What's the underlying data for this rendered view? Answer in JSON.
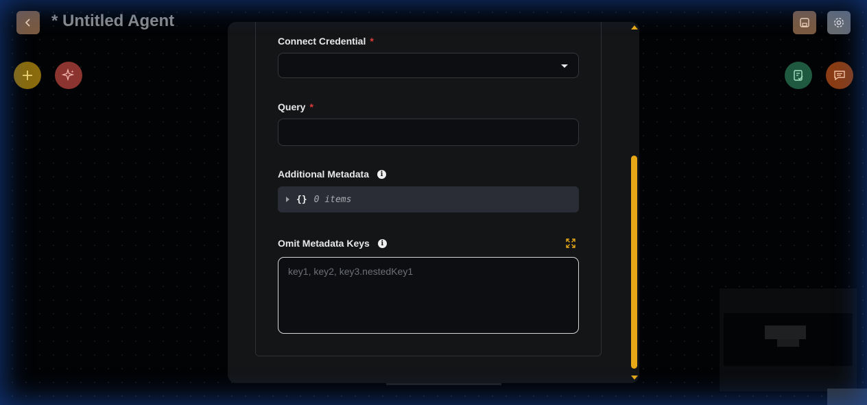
{
  "header": {
    "title": "* Untitled Agent"
  },
  "form": {
    "credential": {
      "label": "Connect Credential",
      "required_mark": "*",
      "value": ""
    },
    "query": {
      "label": "Query",
      "required_mark": "*",
      "value": ""
    },
    "metadata": {
      "label": "Additional Metadata",
      "braces": "{}",
      "count_text": "0 items"
    },
    "omit_keys": {
      "label": "Omit Metadata Keys",
      "placeholder": "key1, key2, key3.nestedKey1"
    }
  },
  "colors": {
    "accent": "#e6a817",
    "required": "#e23b3b",
    "panel_bg": "#141517"
  },
  "icons": [
    "chevron-left-icon",
    "save-icon",
    "gear-icon",
    "plus-icon",
    "sparkles-icon",
    "checklist-icon",
    "chat-icon",
    "info-icon",
    "expand-icon"
  ]
}
